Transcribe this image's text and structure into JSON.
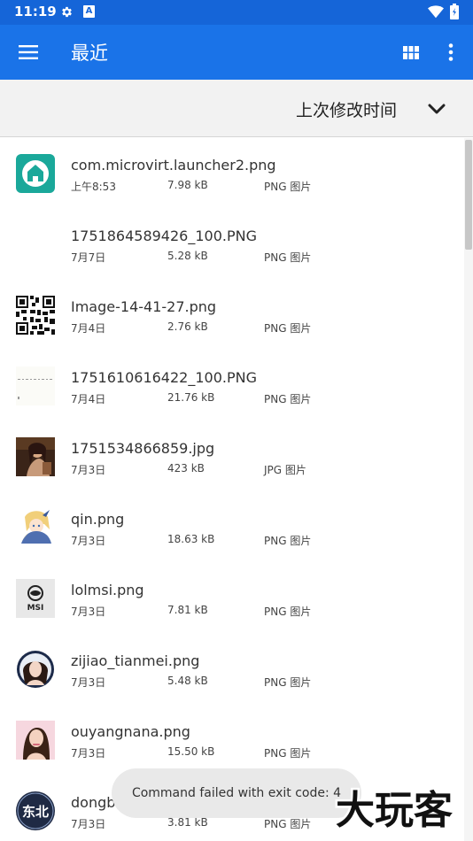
{
  "status_bar": {
    "time": "11:19",
    "icons": [
      "gear-icon",
      "a-badge-icon",
      "wifi-icon",
      "battery-icon"
    ],
    "a_badge": "A"
  },
  "app_bar": {
    "title": "最近",
    "menu_icon": "hamburger-menu-icon",
    "grid_icon": "grid-view-icon",
    "more_icon": "more-vert-icon",
    "color": "#1a73e8"
  },
  "sort": {
    "label": "上次修改时间",
    "icon": "chevron-down-icon"
  },
  "files": [
    {
      "name": "com.microvirt.launcher2.png",
      "date": "上午8:53",
      "size": "7.98 kB",
      "type": "PNG 图片",
      "thumb": "launcher-app-icon"
    },
    {
      "name": "1751864589426_100.PNG",
      "date": "7月7日",
      "size": "5.28 kB",
      "type": "PNG 图片",
      "thumb": "blank-image"
    },
    {
      "name": "Image-14-41-27.png",
      "date": "7月4日",
      "size": "2.76 kB",
      "type": "PNG 图片",
      "thumb": "qr-code-image"
    },
    {
      "name": "1751610616422_100.PNG",
      "date": "7月4日",
      "size": "21.76 kB",
      "type": "PNG 图片",
      "thumb": "faint-text-image"
    },
    {
      "name": "1751534866859.jpg",
      "date": "7月3日",
      "size": "423 kB",
      "type": "JPG 图片",
      "thumb": "photo-portrait"
    },
    {
      "name": "qin.png",
      "date": "7月3日",
      "size": "18.63 kB",
      "type": "PNG 图片",
      "thumb": "anime-character-image"
    },
    {
      "name": "lolmsi.png",
      "date": "7月3日",
      "size": "7.81 kB",
      "type": "PNG 图片",
      "thumb": "msi-logo-image"
    },
    {
      "name": "zijiao_tianmei.png",
      "date": "7月3日",
      "size": "5.48 kB",
      "type": "PNG 图片",
      "thumb": "round-portrait-image"
    },
    {
      "name": "ouyangnana.png",
      "date": "7月3日",
      "size": "15.50 kB",
      "type": "PNG 图片",
      "thumb": "portrait-image"
    },
    {
      "name": "dongbeihua.png",
      "date": "7月3日",
      "size": "3.81 kB",
      "type": "PNG 图片",
      "thumb": "dongbei-text-image",
      "thumb_text": "东北"
    }
  ],
  "toast": {
    "message": "Command failed with exit code: 4"
  },
  "watermark": {
    "text": "大玩客"
  }
}
